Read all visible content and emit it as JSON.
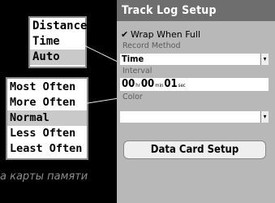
{
  "record_method_popup": {
    "options": [
      "Distance",
      "Time",
      "Auto"
    ],
    "selected": "Auto"
  },
  "interval_popup": {
    "options": [
      "Most Often",
      "More Often",
      "Normal",
      "Less Often",
      "Least Often"
    ],
    "selected": "Normal"
  },
  "screen": {
    "title": "Track Log Setup",
    "wrap_when_full": {
      "checked": true,
      "label": "Wrap When Full",
      "check_glyph": "✔"
    },
    "record_method": {
      "label": "Record Method",
      "value": "Time"
    },
    "interval": {
      "label": "Interval",
      "hours": "00",
      "hours_unit": "hr",
      "minutes": "00",
      "minutes_unit": "min",
      "seconds": "01",
      "seconds_unit": "sec"
    },
    "color": {
      "label": "Color",
      "value": ""
    },
    "data_card_button": "Data Card Setup",
    "dropdown_glyph": "▾"
  },
  "caption": "а карты памяти"
}
